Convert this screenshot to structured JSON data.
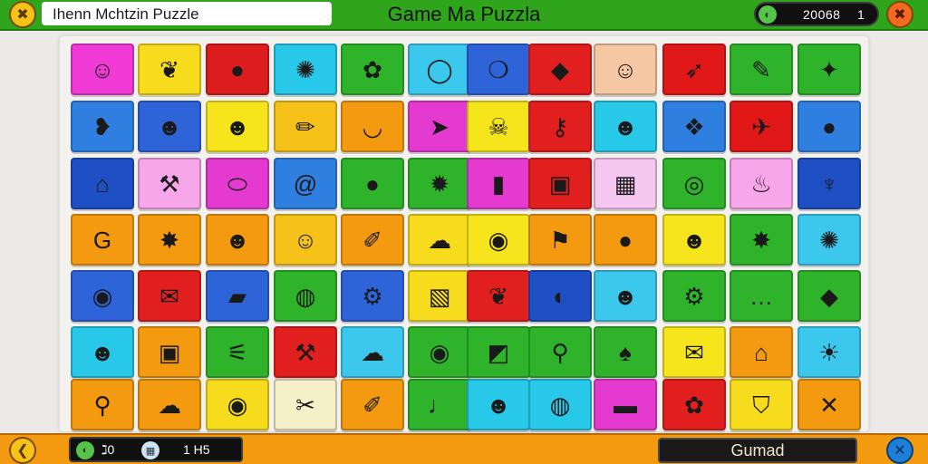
{
  "header": {
    "app_title": "Ihenn Mchtzin Puzzle",
    "game_title": "Game Ma Puzzla",
    "score": "20068",
    "level": "1",
    "left_button_glyph": "✖",
    "right_button_glyph": "✖"
  },
  "footer": {
    "moves_value": "ℷ0",
    "time_value": "1 H5",
    "action_label": "Gumad",
    "back_glyph": "❮",
    "tools_glyph": "✕"
  },
  "board": {
    "rows": [
      [
        {
          "color": "#f03ad6",
          "icon": "smiley-icon",
          "glyph": "☺"
        },
        {
          "color": "#f6dc1c",
          "icon": "leaf-icon",
          "glyph": "❦"
        },
        {
          "color": "#dd1d1d",
          "icon": "sun-icon",
          "glyph": "●"
        },
        {
          "color": "#28c8e8",
          "icon": "crab-icon",
          "glyph": "✺"
        },
        {
          "color": "#2eb32a",
          "icon": "fox-icon",
          "glyph": "✿"
        },
        {
          "color": "#3cc7ec",
          "icon": "bubble-icon",
          "glyph": "◯"
        },
        {
          "color": "#2f63d8",
          "icon": "balloon-icon",
          "glyph": "❍"
        },
        {
          "color": "#e21f1f",
          "icon": "sign-icon",
          "glyph": "◆"
        },
        {
          "color": "#f6c7a3",
          "icon": "cat-face-icon",
          "glyph": "☺"
        },
        {
          "color": "#e01818",
          "icon": "arrow-icon",
          "glyph": "➶"
        },
        {
          "color": "#2eb32a",
          "icon": "rocket-icon",
          "glyph": "✎"
        },
        {
          "color": "#2eb32a",
          "icon": "drop-icon",
          "glyph": "✦"
        }
      ],
      [
        {
          "color": "#2f7fe0",
          "icon": "droplet-icon",
          "glyph": "❥"
        },
        {
          "color": "#2f63d8",
          "icon": "lion-icon",
          "glyph": "☻"
        },
        {
          "color": "#f6e51c",
          "icon": "bear-icon",
          "glyph": "☻"
        },
        {
          "color": "#f6c21a",
          "icon": "pencil-icon",
          "glyph": "✏"
        },
        {
          "color": "#f39a10",
          "icon": "bowl-icon",
          "glyph": "◡"
        },
        {
          "color": "#e43ad0",
          "icon": "fish-icon",
          "glyph": "➤"
        },
        {
          "color": "#f6e51c",
          "icon": "skull-icon",
          "glyph": "☠"
        },
        {
          "color": "#e21f1f",
          "icon": "key-icon",
          "glyph": "⚷"
        },
        {
          "color": "#28c8e8",
          "icon": "duck-icon",
          "glyph": "☻"
        },
        {
          "color": "#2f7fe0",
          "icon": "strawberry-icon",
          "glyph": "❖"
        },
        {
          "color": "#e01818",
          "icon": "bird-icon",
          "glyph": "✈"
        },
        {
          "color": "#2f7fe0",
          "icon": "chat-icon",
          "glyph": "●"
        }
      ],
      [
        {
          "color": "#1f4fc4",
          "icon": "house-icon",
          "glyph": "⌂"
        },
        {
          "color": "#f7a6e9",
          "icon": "tool-icon",
          "glyph": "⚒"
        },
        {
          "color": "#e43ad0",
          "icon": "bandage-icon",
          "glyph": "⬭"
        },
        {
          "color": "#2f7fe0",
          "icon": "swirl-icon",
          "glyph": "@"
        },
        {
          "color": "#2eb32a",
          "icon": "orange-ball-icon",
          "glyph": "●"
        },
        {
          "color": "#2eb32a",
          "icon": "star-burst-icon",
          "glyph": "✹"
        },
        {
          "color": "#e43ad0",
          "icon": "tube-icon",
          "glyph": "▮"
        },
        {
          "color": "#e21f1f",
          "icon": "block-face-icon",
          "glyph": "▣"
        },
        {
          "color": "#f6c7f0",
          "icon": "cube-icon",
          "glyph": "▦"
        },
        {
          "color": "#2eb32a",
          "icon": "ring-icon",
          "glyph": "◎"
        },
        {
          "color": "#f7a6e9",
          "icon": "jar-icon",
          "glyph": "♨"
        },
        {
          "color": "#1f4fc4",
          "icon": "ice-cream-icon",
          "glyph": "♆"
        }
      ],
      [
        {
          "color": "#f39a10",
          "icon": "spiral-icon",
          "glyph": "G"
        },
        {
          "color": "#f39a10",
          "icon": "monster-icon",
          "glyph": "✸"
        },
        {
          "color": "#f39a10",
          "icon": "dog-icon",
          "glyph": "☻"
        },
        {
          "color": "#f6c21a",
          "icon": "grin-icon",
          "glyph": "☺"
        },
        {
          "color": "#f39a10",
          "icon": "carrot-icon",
          "glyph": "✐"
        },
        {
          "color": "#f6dc1c",
          "icon": "sheep-icon",
          "glyph": "☁"
        },
        {
          "color": "#f6e51c",
          "icon": "coil-icon",
          "glyph": "◉"
        },
        {
          "color": "#f39a10",
          "icon": "sign-post-icon",
          "glyph": "⚑"
        },
        {
          "color": "#f39a10",
          "icon": "lemon-icon",
          "glyph": "●"
        },
        {
          "color": "#f6e51c",
          "icon": "frog-icon",
          "glyph": "☻"
        },
        {
          "color": "#2eb32a",
          "icon": "crab-red-icon",
          "glyph": "✸"
        },
        {
          "color": "#3cc7ec",
          "icon": "sun-face-icon",
          "glyph": "✺"
        }
      ],
      [
        {
          "color": "#2f63d8",
          "icon": "donut-icon",
          "glyph": "◉"
        },
        {
          "color": "#e21f1f",
          "icon": "envelope-icon",
          "glyph": "✉"
        },
        {
          "color": "#2f63d8",
          "icon": "ticket-icon",
          "glyph": "▰"
        },
        {
          "color": "#2eb32a",
          "icon": "melon-icon",
          "glyph": "◍"
        },
        {
          "color": "#2f63d8",
          "icon": "gear-icon",
          "glyph": "⚙"
        },
        {
          "color": "#f6dc1c",
          "icon": "photo-icon",
          "glyph": "▧"
        },
        {
          "color": "#e21f1f",
          "icon": "feather-icon",
          "glyph": "❦"
        },
        {
          "color": "#1f4fc4",
          "icon": "magnet-icon",
          "glyph": "◐"
        },
        {
          "color": "#3cc7ec",
          "icon": "chick-icon",
          "glyph": "☻"
        },
        {
          "color": "#2eb32a",
          "icon": "cog-icon",
          "glyph": "⚙"
        },
        {
          "color": "#2eb32a",
          "icon": "bubble-dots-icon",
          "glyph": "…"
        },
        {
          "color": "#2eb32a",
          "icon": "diamond-icon",
          "glyph": "◆"
        }
      ],
      [
        {
          "color": "#28c8e8",
          "icon": "bee-icon",
          "glyph": "☻"
        },
        {
          "color": "#f39a10",
          "icon": "box-face-icon",
          "glyph": "▣"
        },
        {
          "color": "#2eb32a",
          "icon": "saw-icon",
          "glyph": "⚟"
        },
        {
          "color": "#e21f1f",
          "icon": "pickaxe-icon",
          "glyph": "⚒"
        },
        {
          "color": "#3cc7ec",
          "icon": "hippo-icon",
          "glyph": "☁"
        },
        {
          "color": "#2eb32a",
          "icon": "eye-icon",
          "glyph": "◉"
        },
        {
          "color": "#2eb32a",
          "icon": "frame-icon",
          "glyph": "◩"
        },
        {
          "color": "#2eb32a",
          "icon": "search-icon",
          "glyph": "⚲"
        },
        {
          "color": "#2eb32a",
          "icon": "ghost-icon",
          "glyph": "♠"
        },
        {
          "color": "#f6e51c",
          "icon": "mail-icon",
          "glyph": "✉"
        },
        {
          "color": "#f39a10",
          "icon": "arch-icon",
          "glyph": "⌂"
        },
        {
          "color": "#3cc7ec",
          "icon": "bulb-icon",
          "glyph": "☀"
        }
      ],
      [
        {
          "color": "#f39a10",
          "icon": "magnifier-icon",
          "glyph": "⚲"
        },
        {
          "color": "#f39a10",
          "icon": "cloud-icon",
          "glyph": "☁"
        },
        {
          "color": "#f6dc1c",
          "icon": "eye-face-icon",
          "glyph": "◉"
        },
        {
          "color": "#f6f0c8",
          "icon": "scissors-icon",
          "glyph": "✂"
        },
        {
          "color": "#f39a10",
          "icon": "brush-icon",
          "glyph": "✐"
        },
        {
          "color": "#2eb32a",
          "icon": "spoon-icon",
          "glyph": "♩"
        },
        {
          "color": "#28c8e8",
          "icon": "blob-icon",
          "glyph": "☻"
        },
        {
          "color": "#28c8e8",
          "icon": "ball-icon",
          "glyph": "◍"
        },
        {
          "color": "#e43ad0",
          "icon": "tray-icon",
          "glyph": "▬"
        },
        {
          "color": "#e21f1f",
          "icon": "flower-icon",
          "glyph": "✿"
        },
        {
          "color": "#f6dc1c",
          "icon": "shield-icon",
          "glyph": "⛉"
        },
        {
          "color": "#f39a10",
          "icon": "x-mark-icon",
          "glyph": "✕"
        }
      ]
    ]
  }
}
